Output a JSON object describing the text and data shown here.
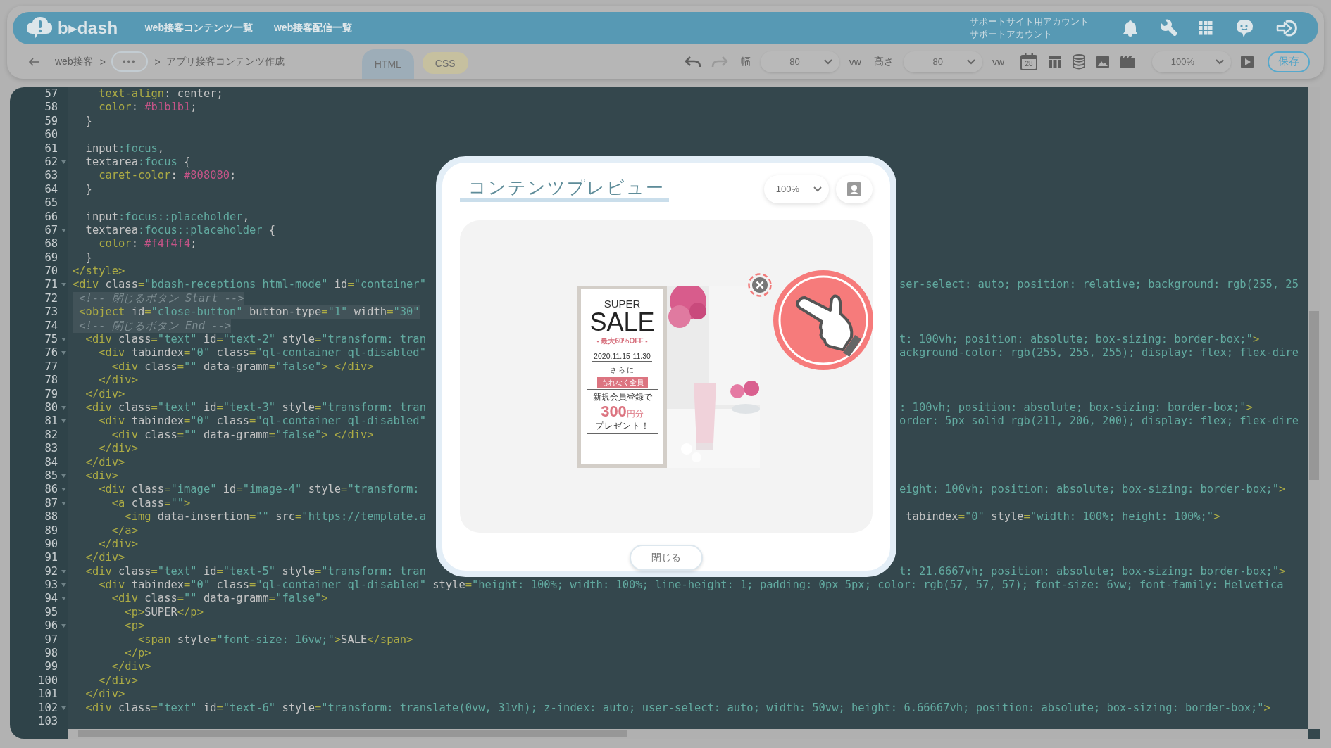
{
  "header": {
    "logo": "b▸dash",
    "nav": [
      {
        "label": "web接客コンテンツ一覧"
      },
      {
        "label": "web接客配信一覧"
      }
    ],
    "account": {
      "site": "サポートサイト用アカウント",
      "user": "サポートアカウント"
    }
  },
  "toolbar": {
    "breadcrumb": [
      {
        "kind": "link",
        "label": "web接客"
      },
      {
        "kind": "separator",
        "label": ">"
      },
      {
        "kind": "more",
        "label": "•••"
      },
      {
        "kind": "separator",
        "label": ">"
      },
      {
        "kind": "current",
        "label": "アプリ接客コンテンツ作成"
      }
    ],
    "tabs": [
      {
        "label": "HTML",
        "selected": true
      },
      {
        "label": "CSS",
        "selected": false
      }
    ],
    "width": {
      "label": "幅",
      "value": "80",
      "unit": "vw"
    },
    "height": {
      "label": "高さ",
      "value": "80",
      "unit": "vw"
    },
    "calendar_day": "28",
    "zoom": "100%",
    "save": "保存"
  },
  "editor": {
    "lines": [
      {
        "number": "57",
        "text": "    text-align: center;",
        "foldable": false,
        "highlighted": false
      },
      {
        "number": "58",
        "text": "    color: #b1b1b1;",
        "foldable": false,
        "highlighted": false
      },
      {
        "number": "59",
        "text": "  }",
        "foldable": false,
        "highlighted": false
      },
      {
        "number": "60",
        "foldable": false,
        "highlighted": false
      },
      {
        "number": "61",
        "text": "  input:focus,",
        "foldable": false,
        "highlighted": false
      },
      {
        "number": "62",
        "text": "  textarea:focus {",
        "foldable": true,
        "highlighted": false
      },
      {
        "number": "63",
        "text": "    caret-color: #808080;",
        "foldable": false,
        "highlighted": false
      },
      {
        "number": "64",
        "text": "  }",
        "foldable": false,
        "highlighted": false
      },
      {
        "number": "65",
        "foldable": false,
        "highlighted": false
      },
      {
        "number": "66",
        "text": "  input:focus::placeholder,",
        "foldable": false,
        "highlighted": false
      },
      {
        "number": "67",
        "text": "  textarea:focus::placeholder {",
        "foldable": true,
        "highlighted": false
      },
      {
        "number": "68",
        "text": "    color: #f4f4f4;",
        "foldable": false,
        "highlighted": false
      },
      {
        "number": "69",
        "text": "  }",
        "foldable": false,
        "highlighted": false
      },
      {
        "number": "70",
        "text": "</style>",
        "foldable": false,
        "highlighted": false
      },
      {
        "number": "71",
        "text": "<div class=\"bdash-receptions html-mode\" id=\"container\"",
        "right": "ser-select: auto; position: relative; background: rgb(255, 25",
        "foldable": true,
        "highlighted": false
      },
      {
        "number": "72",
        "text": " <!-- 閉じるボタン Start -->",
        "foldable": false,
        "highlighted": true
      },
      {
        "number": "73",
        "text": " <object id=\"close-button\" button-type=\"1\" width=\"30\"",
        "foldable": false,
        "highlighted": true
      },
      {
        "number": "74",
        "text": " <!-- 閉じるボタン End -->",
        "foldable": false,
        "highlighted": true
      },
      {
        "number": "75",
        "text": "  <div class=\"text\" id=\"text-2\" style=\"transform: tran",
        "right": "t: 100vh; position: absolute; box-sizing: border-box;\">",
        "foldable": true,
        "highlighted": false
      },
      {
        "number": "76",
        "text": "    <div tabindex=\"0\" class=\"ql-container ql-disabled\"",
        "right": "ackground-color: rgb(255, 255, 255); display: flex; flex-dire",
        "foldable": true,
        "highlighted": false
      },
      {
        "number": "77",
        "text": "      <div class=\"\" data-gramm=\"false\"> </div>",
        "foldable": false,
        "highlighted": false
      },
      {
        "number": "78",
        "text": "    </div>",
        "foldable": false,
        "highlighted": false
      },
      {
        "number": "79",
        "text": "  </div>",
        "foldable": false,
        "highlighted": false
      },
      {
        "number": "80",
        "text": "  <div class=\"text\" id=\"text-3\" style=\"transform: tran",
        "right": ": 100vh; position: absolute; box-sizing: border-box;\">",
        "foldable": true,
        "highlighted": false
      },
      {
        "number": "81",
        "text": "    <div tabindex=\"0\" class=\"ql-container ql-disabled\"",
        "right": "order: 5px solid rgb(211, 206, 200); display: flex; flex-dire",
        "foldable": true,
        "highlighted": false
      },
      {
        "number": "82",
        "text": "      <div class=\"\" data-gramm=\"false\"> </div>",
        "foldable": false,
        "highlighted": false
      },
      {
        "number": "83",
        "text": "    </div>",
        "foldable": false,
        "highlighted": false
      },
      {
        "number": "84",
        "text": "  </div>",
        "foldable": false,
        "highlighted": false
      },
      {
        "number": "85",
        "text": "  <div>",
        "foldable": true,
        "highlighted": false
      },
      {
        "number": "86",
        "text": "    <div class=\"image\" id=\"image-4\" style=\"transform:",
        "right": "eight: 100vh; position: absolute; box-sizing: border-box;\">",
        "foldable": true,
        "highlighted": false
      },
      {
        "number": "87",
        "text": "      <a class=\"\">",
        "foldable": true,
        "highlighted": false
      },
      {
        "number": "88",
        "text": "        <img data-insertion=\"\" src=\"https://template.a",
        "right": " tabindex=\"0\" style=\"width: 100%; height: 100%;\">",
        "foldable": false,
        "highlighted": false
      },
      {
        "number": "89",
        "text": "      </a>",
        "foldable": false,
        "highlighted": false
      },
      {
        "number": "90",
        "text": "    </div>",
        "foldable": false,
        "highlighted": false
      },
      {
        "number": "91",
        "text": "  </div>",
        "foldable": false,
        "highlighted": false
      },
      {
        "number": "92",
        "text": "  <div class=\"text\" id=\"text-5\" style=\"transform: tran",
        "right": "t: 21.6667vh; position: absolute; box-sizing: border-box;\">",
        "foldable": true,
        "highlighted": false
      },
      {
        "number": "93",
        "text": "    <div tabindex=\"0\" class=\"ql-container ql-disabled\" style=\"height: 100%; width: 100%; line-height: 1; padding: 0px 5px; color: rgb(57, 57, 57); font-size: 6vw; font-family: Helvetica",
        "foldable": true,
        "highlighted": false
      },
      {
        "number": "94",
        "text": "      <div class=\"\" data-gramm=\"false\">",
        "foldable": true,
        "highlighted": false
      },
      {
        "number": "95",
        "text": "        <p>SUPER</p>",
        "foldable": false,
        "highlighted": false
      },
      {
        "number": "96",
        "text": "        <p>",
        "foldable": true,
        "highlighted": false
      },
      {
        "number": "97",
        "text": "          <span style=\"font-size: 16vw;\">SALE</span>",
        "foldable": false,
        "highlighted": false
      },
      {
        "number": "98",
        "text": "        </p>",
        "foldable": false,
        "highlighted": false
      },
      {
        "number": "99",
        "text": "      </div>",
        "foldable": false,
        "highlighted": false
      },
      {
        "number": "100",
        "text": "    </div>",
        "foldable": false,
        "highlighted": false
      },
      {
        "number": "101",
        "text": "  </div>",
        "foldable": false,
        "highlighted": false
      },
      {
        "number": "102",
        "text": "  <div class=\"text\" id=\"text-6\" style=\"transform: translate(0vw, 31vh); z-index: auto; user-select: auto; width: 50vw; height: 6.66667vh; position: absolute; box-sizing: border-box;\">",
        "foldable": true,
        "highlighted": false
      },
      {
        "number": "103",
        "foldable": false,
        "highlighted": false
      }
    ]
  },
  "preview": {
    "title": "コンテンツプレビュー",
    "zoom": "100%",
    "banner": {
      "super": "SUPER",
      "sale": "SALE",
      "discount": "- 最大60%OFF -",
      "period": "2020.11.15-11.30",
      "more": "さらに",
      "ribbon": "もれなく全員",
      "signup": "新規会員登録で",
      "amount": "300",
      "amount_unit": "円分",
      "gift": "プレゼント！"
    },
    "close": "閉じる"
  }
}
